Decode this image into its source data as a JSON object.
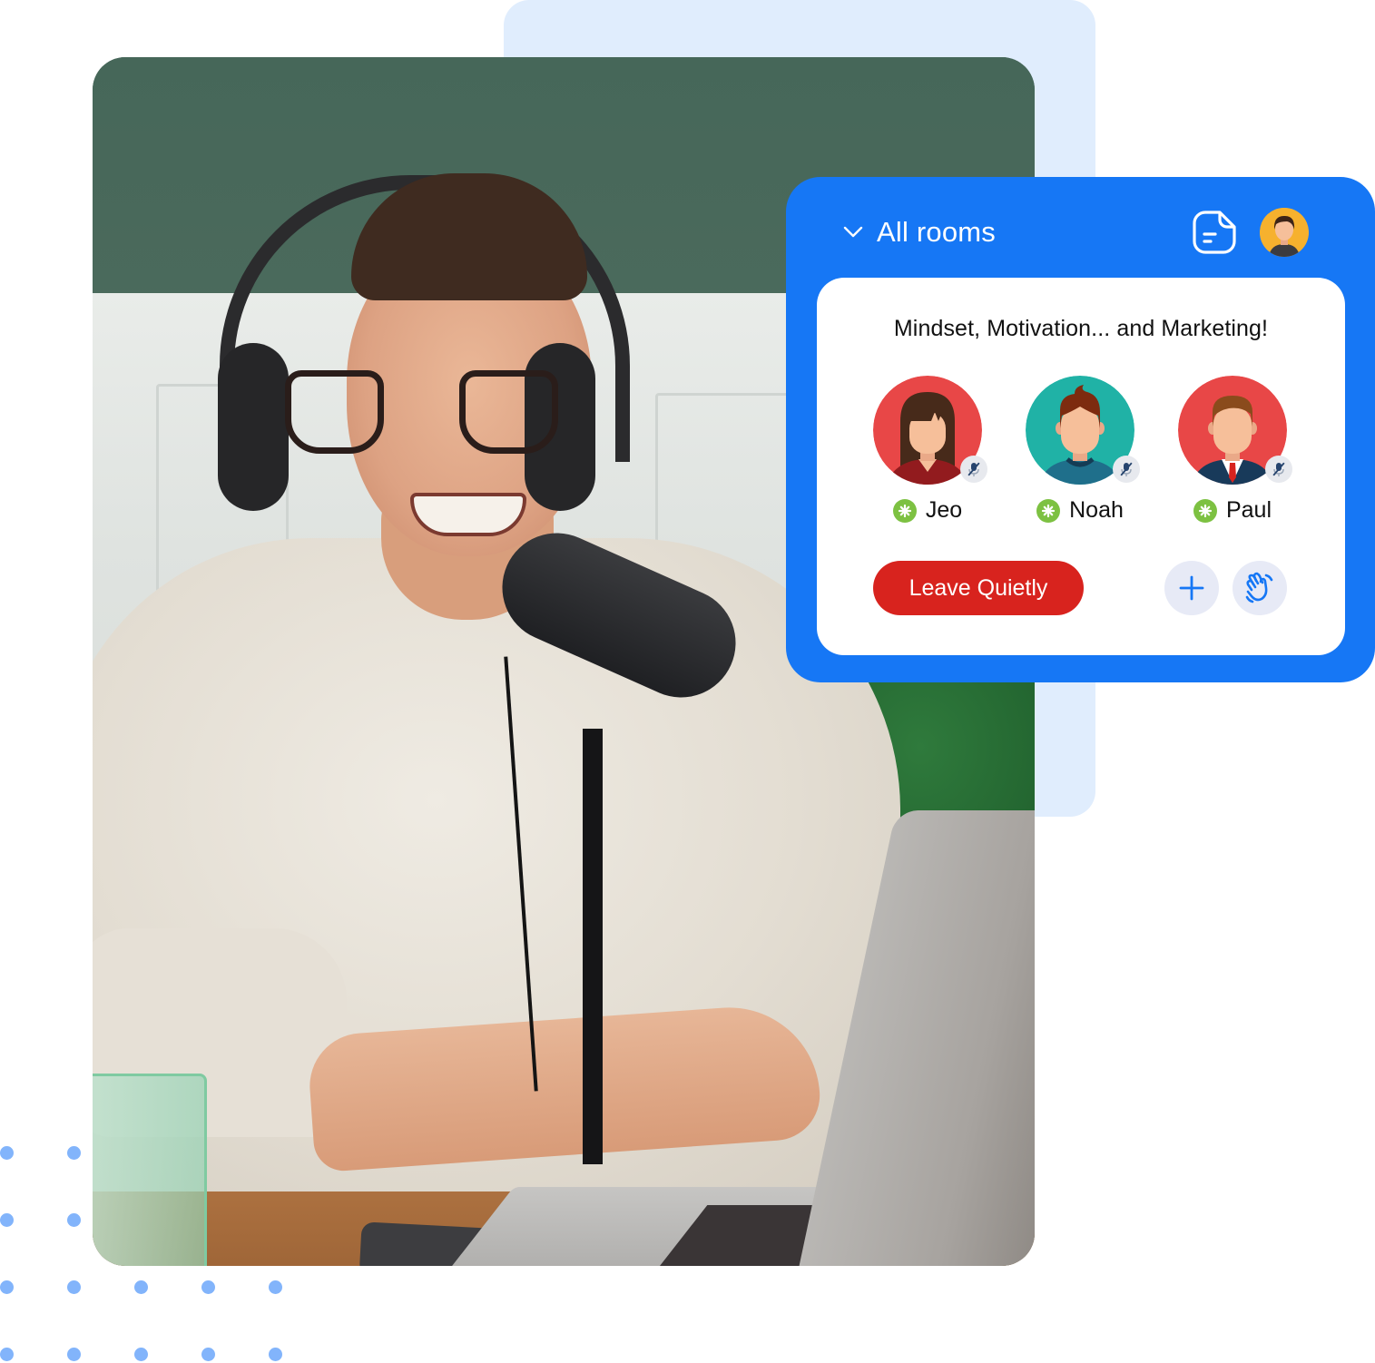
{
  "photo": {
    "description": "Smiling man with glasses and headphones speaking into a podcast microphone at a laptop"
  },
  "room_panel": {
    "header": {
      "chevron_icon": "chevron-down-icon",
      "title": "All rooms",
      "notes_icon": "note-icon",
      "me_avatar_icon": "user-avatar-icon"
    },
    "room": {
      "name": "Mindset, Motivation... and Marketing!",
      "participants": [
        {
          "name": "Jeo",
          "avatar_color": "#e84747",
          "status": "active",
          "muted": true
        },
        {
          "name": "Noah",
          "avatar_color": "#20b2a6",
          "status": "active",
          "muted": true
        },
        {
          "name": "Paul",
          "avatar_color": "#e84747",
          "status": "active",
          "muted": true
        }
      ],
      "actions": {
        "leave_label": "Leave Quietly",
        "add_icon": "plus-icon",
        "wave_icon": "wave-hand-icon"
      }
    }
  },
  "colors": {
    "panel_blue": "#1677f5",
    "leave_red": "#d8231e",
    "status_green": "#7dc142",
    "backdrop_blue": "#e0edfd",
    "dot_blue": "#82b4fb"
  }
}
